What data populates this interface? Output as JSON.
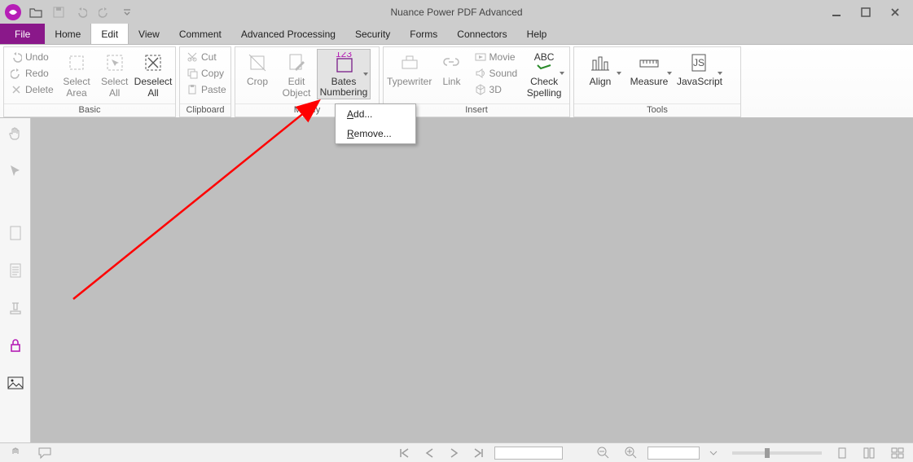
{
  "app": {
    "title": "Nuance Power PDF Advanced"
  },
  "tabs": {
    "file": "File",
    "items": [
      "Home",
      "Edit",
      "View",
      "Comment",
      "Advanced Processing",
      "Security",
      "Forms",
      "Connectors",
      "Help"
    ],
    "active_index": 1
  },
  "ribbon": {
    "basic": {
      "label": "Basic",
      "undo": "Undo",
      "redo": "Redo",
      "delete": "Delete",
      "select_area": "Select Area",
      "select_all": "Select All",
      "deselect_all": "Deselect All"
    },
    "clipboard": {
      "label": "Clipboard",
      "cut": "Cut",
      "copy": "Copy",
      "paste": "Paste"
    },
    "modify": {
      "label": "Modify",
      "crop": "Crop",
      "edit_object": "Edit Object",
      "bates": "Bates Numbering",
      "bates_icon_label": "123"
    },
    "insert": {
      "label": "Insert",
      "typewriter": "Typewriter",
      "link": "Link",
      "movie": "Movie",
      "sound": "Sound",
      "threeD": "3D",
      "spell": "Check Spelling",
      "spell_abc": "ABC"
    },
    "tools": {
      "label": "Tools",
      "align": "Align",
      "measure": "Measure",
      "javascript": "JavaScript",
      "js_badge": "JS"
    }
  },
  "dropdown": {
    "add": "Add...",
    "remove": "Remove...",
    "add_u": "A",
    "remove_u": "R"
  },
  "annotation": {
    "color": "#ff0000"
  }
}
